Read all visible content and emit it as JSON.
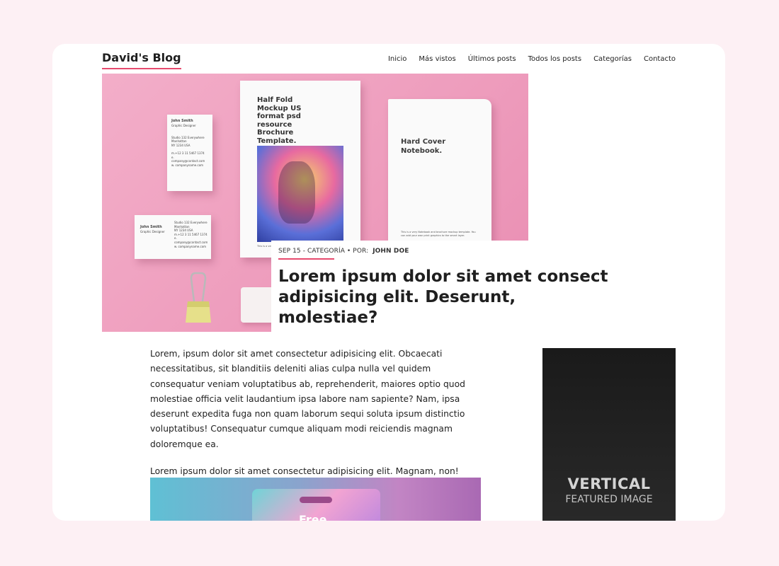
{
  "site": {
    "title": "David's Blog"
  },
  "nav": {
    "items": [
      "Inicio",
      "Más vistos",
      "Últimos posts",
      "Todos los posts",
      "Categorías",
      "Contacto"
    ]
  },
  "hero_image": {
    "card1": {
      "name": "John Smith",
      "role": "Graphic Designer",
      "address": [
        "Studio 132 Everywhere",
        "Manhattan",
        "NY 1234 USA"
      ],
      "contact": [
        "m.+12 3 11 5467 1374",
        "e. company@contact.com",
        "w. companyname.com"
      ]
    },
    "card2": {
      "name": "John Smith",
      "role": "Graphic Designer",
      "address": [
        "Studio 132 Everywhere",
        "Manhattan",
        "NY 1234 USA"
      ],
      "contact": [
        "m.+12 3 11 5467 1374",
        "e. company@contact.com",
        "w. companyname.com"
      ]
    },
    "brochure_text": "Half Fold Mockup US format psd resource Brochure Template.",
    "brochure_fine": "This is a very modern half fold psd brochure mockup template.",
    "notebook_text": "Hard Cover Notebook.",
    "notebook_fine": "This is a very Notebook and brochure mockup template. You can add your own print graphics to the smart layer."
  },
  "post": {
    "date": "SEP 15",
    "category_label": "- CATEGORÍA • POR:",
    "author": "JOHN DOE",
    "title": "Lorem ipsum dolor sit amet consect adipisicing elit. Deserunt, molestiae?",
    "paragraphs": [
      "Lorem, ipsum dolor sit amet consectetur adipisicing elit. Obcaecati necessitatibus, sit blanditiis deleniti alias culpa nulla vel quidem consequatur veniam voluptatibus ab, reprehenderit, maiores optio quod molestiae officia velit laudantium ipsa labore nam sapiente? Nam, ipsa deserunt expedita fuga non quam laborum sequi soluta ipsum distinctio voluptatibus! Consequatur cumque aliquam modi reiciendis magnam doloremque ea.",
      "Lorem ipsum dolor sit amet consectetur adipisicing elit. Magnam, non!"
    ],
    "inline_image_text": "Free"
  },
  "sidebar": {
    "featured_line1": "VERTICAL",
    "featured_line2": "FEATURED IMAGE"
  },
  "colors": {
    "accent": "#e64a6e",
    "page_bg": "#fdf0f4",
    "hero_pink": "#ee9dbd",
    "sidebar_dark": "#1f1f1f"
  }
}
